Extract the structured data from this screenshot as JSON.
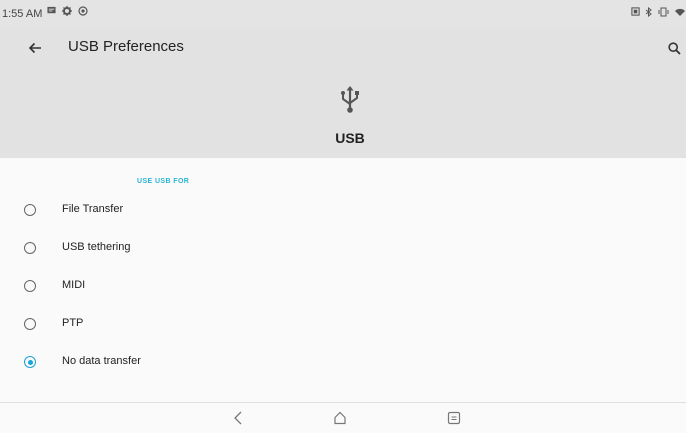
{
  "status_bar": {
    "time": "1:55 AM",
    "notification_icons": [
      "message-icon",
      "settings-icon",
      "sync-icon"
    ],
    "system_icons": [
      "screenshot-icon",
      "bluetooth-icon",
      "vibrate-icon",
      "wifi-icon"
    ]
  },
  "toolbar": {
    "title": "USB Preferences",
    "back_icon": "arrow-left-icon",
    "search_icon": "search-icon"
  },
  "header": {
    "icon": "usb-icon",
    "label": "USB"
  },
  "section": {
    "title": "USE USB FOR"
  },
  "options": [
    {
      "label": "File Transfer",
      "selected": false
    },
    {
      "label": "USB tethering",
      "selected": false
    },
    {
      "label": "MIDI",
      "selected": false
    },
    {
      "label": "PTP",
      "selected": false
    },
    {
      "label": "No data transfer",
      "selected": true
    }
  ],
  "navigation": {
    "buttons": [
      "back-icon",
      "home-icon",
      "recents-icon"
    ]
  },
  "colors": {
    "accent": "#1aa3d8",
    "section_header": "#29b6d4",
    "header_background": "#e2e2e2",
    "page_background": "#fafafa"
  }
}
